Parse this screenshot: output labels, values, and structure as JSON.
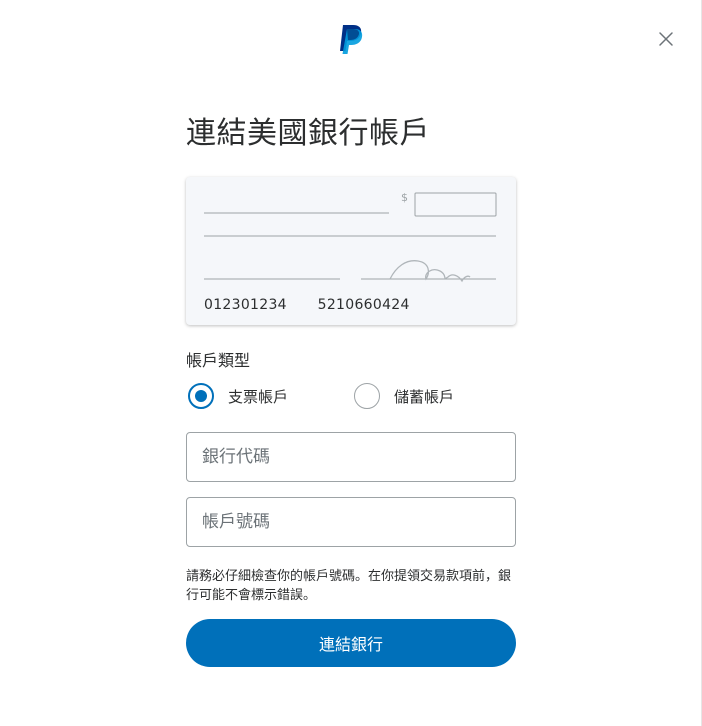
{
  "colors": {
    "brand_dark": "#003087",
    "brand_light": "#009cde",
    "primary_button": "#0070ba",
    "text": "#2c2e2f"
  },
  "header": {
    "logo_icon": "paypal-logo",
    "close_icon": "close-x-icon"
  },
  "title": "連結美國銀行帳戶",
  "check_illustration": {
    "currency_symbol": "$",
    "routing_number": "012301234",
    "account_number": "5210660424"
  },
  "account_type": {
    "label": "帳戶類型",
    "options": [
      {
        "label": "支票帳戶",
        "selected": true
      },
      {
        "label": "儲蓄帳戶",
        "selected": false
      }
    ]
  },
  "fields": {
    "routing": {
      "placeholder": "銀行代碼",
      "value": ""
    },
    "account": {
      "placeholder": "帳戶號碼",
      "value": ""
    }
  },
  "disclaimer": "請務必仔細檢查你的帳戶號碼。在你提領交易款項前，銀行可能不會標示錯誤。",
  "submit_label": "連結銀行"
}
